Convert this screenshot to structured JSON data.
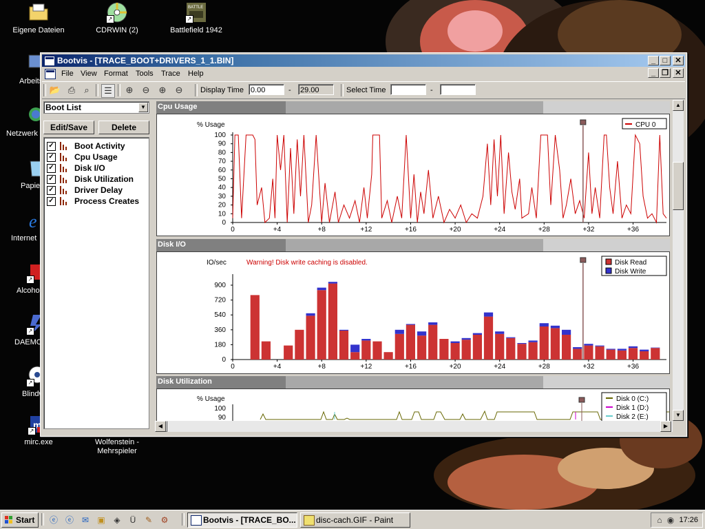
{
  "desktop": {
    "icons": [
      {
        "label": "Eigene Dateien",
        "name": "desktop-icon-eigene-dateien"
      },
      {
        "label": "CDRWIN (2)",
        "name": "desktop-icon-cdrwin"
      },
      {
        "label": "Battlefield 1942",
        "name": "desktop-icon-battlefield"
      },
      {
        "label": "Arbeits",
        "name": "desktop-icon-arbeitsplatz"
      },
      {
        "label": "Netzwerk",
        "name": "desktop-icon-netzwerk"
      },
      {
        "label": "Papier",
        "name": "desktop-icon-papierkorb"
      },
      {
        "label": "Internet",
        "name": "desktop-icon-internet"
      },
      {
        "label": "Alcohol",
        "name": "desktop-icon-alcohol"
      },
      {
        "label": "DAEMO",
        "name": "desktop-icon-daemon"
      },
      {
        "label": "Blindw",
        "name": "desktop-icon-blindwrite"
      },
      {
        "label": "mirc.exe",
        "name": "desktop-icon-mirc"
      },
      {
        "label": "Wolfenstein -\nMehrspieler",
        "name": "desktop-icon-wolfenstein"
      }
    ]
  },
  "window": {
    "title": "Bootvis - [TRACE_BOOT+DRIVERS_1_1.BIN]",
    "menu": [
      "File",
      "View",
      "Format",
      "Tools",
      "Trace",
      "Help"
    ],
    "toolbar": {
      "display_time_label": "Display Time",
      "display_time_from": "0.00",
      "dash": "-",
      "display_time_to": "29.00",
      "select_time_label": "Select Time",
      "select_time_from": "",
      "select_time_to": ""
    },
    "left_panel": {
      "combo_value": "Boot List",
      "edit_save": "Edit/Save",
      "delete": "Delete",
      "items": [
        "Boot Activity",
        "Cpu Usage",
        "Disk I/O",
        "Disk Utilization",
        "Driver Delay",
        "Process Creates"
      ]
    }
  },
  "graphs": {
    "cpu": {
      "header": "Cpu Usage",
      "ylabel": "% Usage",
      "legend": "CPU 0"
    },
    "disk": {
      "header": "Disk I/O",
      "ylabel": "IO/sec",
      "warning": "Warning!  Disk write caching is disabled.",
      "legend_read": "Disk Read",
      "legend_write": "Disk Write"
    },
    "util": {
      "header": "Disk Utilization",
      "ylabel": "% Usage",
      "legend": [
        "Disk 0 (C:)",
        "Disk 1 (D:)",
        "Disk 2 (E:)"
      ]
    }
  },
  "colors": {
    "cpu_line": "#cc0000",
    "disk_read": "#cc3333",
    "disk_write": "#3333cc",
    "disk0": "#666600",
    "disk1": "#cc00cc",
    "disk2": "#66cccc",
    "marker": "#8b5a5a"
  },
  "chart_data": [
    {
      "type": "line",
      "title": "Cpu Usage",
      "ylabel": "% Usage",
      "xlim": [
        0,
        39
      ],
      "ylim": [
        0,
        100
      ],
      "xticks": [
        "0",
        "+4",
        "+8",
        "+12",
        "+16",
        "+20",
        "+24",
        "+28",
        "+32",
        "+36",
        "+"
      ],
      "yticks": [
        0,
        10,
        20,
        30,
        40,
        50,
        60,
        70,
        80,
        90,
        100
      ],
      "series": [
        {
          "name": "CPU 0",
          "points": [
            [
              0,
              5
            ],
            [
              0.2,
              100
            ],
            [
              0.5,
              100
            ],
            [
              0.8,
              5
            ],
            [
              1.2,
              100
            ],
            [
              1.8,
              100
            ],
            [
              2,
              95
            ],
            [
              2.2,
              20
            ],
            [
              2.6,
              40
            ],
            [
              2.9,
              0
            ],
            [
              3.3,
              5
            ],
            [
              3.6,
              50
            ],
            [
              3.8,
              5
            ],
            [
              4,
              100
            ],
            [
              4.3,
              60
            ],
            [
              4.6,
              100
            ],
            [
              4.9,
              0
            ],
            [
              5.2,
              85
            ],
            [
              5.5,
              10
            ],
            [
              5.8,
              95
            ],
            [
              6.1,
              30
            ],
            [
              6.4,
              100
            ],
            [
              6.8,
              0
            ],
            [
              7.1,
              20
            ],
            [
              7.5,
              100
            ],
            [
              7.7,
              60
            ],
            [
              8,
              0
            ],
            [
              8.3,
              45
            ],
            [
              8.7,
              0
            ],
            [
              9.2,
              35
            ],
            [
              9.5,
              0
            ],
            [
              10,
              20
            ],
            [
              10.5,
              5
            ],
            [
              11,
              25
            ],
            [
              11.4,
              0
            ],
            [
              11.8,
              40
            ],
            [
              12.1,
              5
            ],
            [
              12.5,
              55
            ],
            [
              12.6,
              100
            ],
            [
              13.2,
              100
            ],
            [
              13.4,
              5
            ],
            [
              13.9,
              25
            ],
            [
              14.3,
              0
            ],
            [
              14.8,
              30
            ],
            [
              15.2,
              5
            ],
            [
              15.6,
              100
            ],
            [
              16,
              5
            ],
            [
              16.3,
              55
            ],
            [
              16.6,
              0
            ],
            [
              16.9,
              35
            ],
            [
              17.2,
              10
            ],
            [
              17.6,
              60
            ],
            [
              18,
              5
            ],
            [
              18.5,
              30
            ],
            [
              19,
              0
            ],
            [
              19.5,
              15
            ],
            [
              20,
              5
            ],
            [
              20.5,
              20
            ],
            [
              21,
              0
            ],
            [
              21.5,
              10
            ],
            [
              22,
              5
            ],
            [
              22.5,
              30
            ],
            [
              22.9,
              90
            ],
            [
              23.2,
              20
            ],
            [
              23.5,
              95
            ],
            [
              23.8,
              30
            ],
            [
              24.1,
              100
            ],
            [
              24.4,
              10
            ],
            [
              24.8,
              80
            ],
            [
              25.1,
              35
            ],
            [
              25.4,
              15
            ],
            [
              25.8,
              50
            ],
            [
              26,
              5
            ],
            [
              26.6,
              10
            ],
            [
              26.9,
              40
            ],
            [
              27.3,
              5
            ],
            [
              27.7,
              100
            ],
            [
              28.3,
              100
            ],
            [
              28.6,
              20
            ],
            [
              29,
              100
            ],
            [
              29.4,
              60
            ],
            [
              29.7,
              5
            ],
            [
              30,
              20
            ],
            [
              30.4,
              50
            ],
            [
              30.8,
              10
            ],
            [
              31.2,
              25
            ],
            [
              31.6,
              5
            ],
            [
              32,
              80
            ],
            [
              32.3,
              10
            ],
            [
              32.6,
              40
            ],
            [
              33,
              5
            ],
            [
              33.4,
              100
            ],
            [
              33.6,
              100
            ],
            [
              33.9,
              40
            ],
            [
              34.2,
              10
            ],
            [
              34.6,
              70
            ],
            [
              35,
              5
            ],
            [
              35.4,
              20
            ],
            [
              35.8,
              10
            ],
            [
              36.2,
              100
            ],
            [
              36.6,
              90
            ],
            [
              36.9,
              30
            ],
            [
              37.3,
              5
            ],
            [
              37.7,
              10
            ],
            [
              38.1,
              0
            ],
            [
              38.4,
              100
            ],
            [
              38.7,
              10
            ],
            [
              39,
              5
            ]
          ]
        }
      ],
      "marker_x": 31.5
    },
    {
      "type": "bar",
      "title": "Disk I/O",
      "ylabel": "IO/sec",
      "xlim": [
        0,
        39
      ],
      "ylim": [
        0,
        1000
      ],
      "xticks": [
        "0",
        "+4",
        "+8",
        "+12",
        "+16",
        "+20",
        "+24",
        "+28",
        "+32",
        "+36",
        "+"
      ],
      "yticks": [
        0,
        180,
        360,
        540,
        720,
        900
      ],
      "x": [
        2,
        3,
        4,
        5,
        6,
        7,
        8,
        9,
        10,
        11,
        12,
        13,
        14,
        15,
        16,
        17,
        18,
        19,
        20,
        21,
        22,
        23,
        24,
        25,
        26,
        27,
        28,
        29,
        30,
        31,
        32,
        33,
        34,
        35,
        36,
        37,
        38
      ],
      "series": [
        {
          "name": "Disk Read",
          "values": [
            780,
            220,
            0,
            170,
            360,
            530,
            840,
            920,
            350,
            90,
            230,
            220,
            90,
            310,
            420,
            290,
            420,
            250,
            200,
            240,
            300,
            520,
            310,
            260,
            190,
            210,
            400,
            380,
            300,
            130,
            170,
            160,
            120,
            110,
            140,
            100,
            140
          ]
        },
        {
          "name": "Disk Write",
          "values": [
            0,
            0,
            0,
            0,
            0,
            30,
            30,
            20,
            10,
            90,
            20,
            0,
            0,
            50,
            10,
            50,
            30,
            0,
            20,
            20,
            20,
            50,
            30,
            10,
            10,
            20,
            40,
            30,
            60,
            20,
            20,
            10,
            10,
            20,
            20,
            20,
            5
          ]
        }
      ],
      "marker_x": 31.5
    },
    {
      "type": "line",
      "title": "Disk Utilization",
      "ylabel": "% Usage",
      "ylim": [
        0,
        100
      ],
      "yticks": [
        90,
        100
      ],
      "series": [
        {
          "name": "Disk 0 (C:)"
        },
        {
          "name": "Disk 1 (D:)"
        },
        {
          "name": "Disk 2 (E:)"
        }
      ]
    }
  ],
  "taskbar": {
    "start": "Start",
    "tasks": [
      "Bootvis - [TRACE_BO...",
      "disc-cach.GIF - Paint"
    ],
    "clock": "17:26"
  }
}
